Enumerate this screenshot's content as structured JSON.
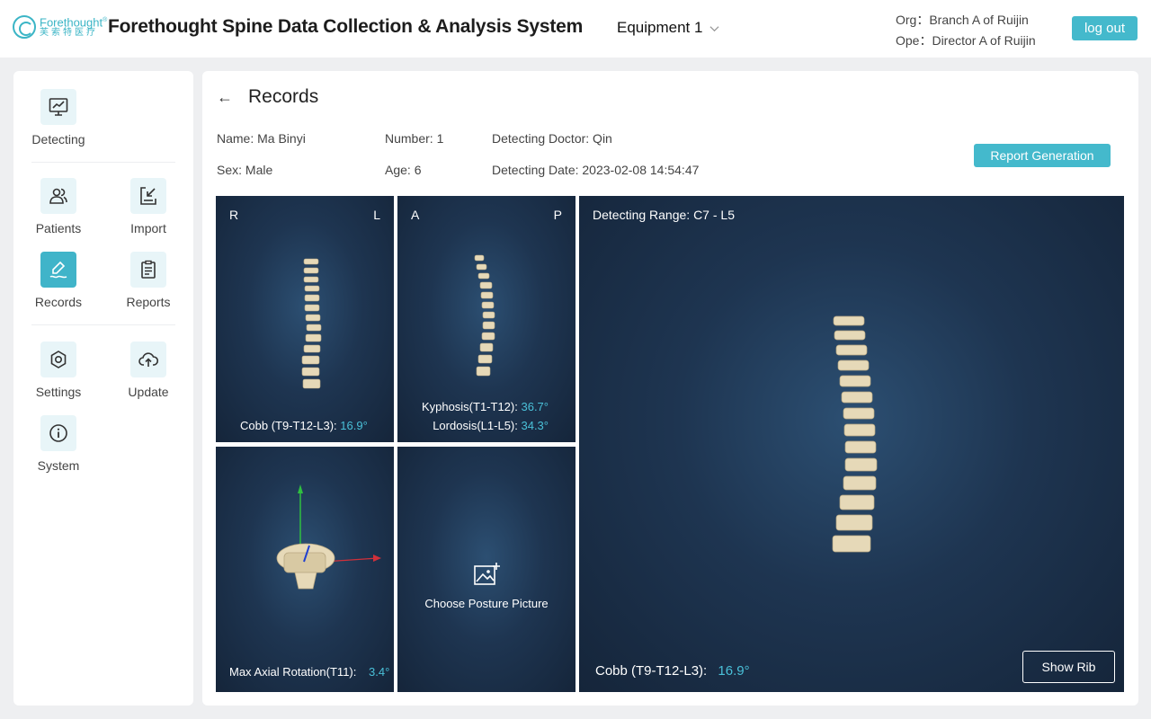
{
  "header": {
    "logo_en": "Forethought",
    "logo_cn": "芙索特医疗",
    "title": "Forethought Spine Data Collection & Analysis System",
    "equipment": "Equipment 1",
    "org": "Org：Branch A of Ruijin",
    "ope": "Ope：Director A of Ruijin",
    "logout_label": "log out"
  },
  "sidebar": {
    "detecting": "Detecting",
    "patients": "Patients",
    "import": "Import",
    "records": "Records",
    "reports": "Reports",
    "settings": "Settings",
    "update": "Update",
    "system": "System"
  },
  "page": {
    "back": "←",
    "title": "Records",
    "report_button": "Report Generation"
  },
  "patient": {
    "name": "Name: Ma Binyi",
    "number": "Number: 1",
    "doctor": "Detecting Doctor: Qin",
    "sex": "Sex: Male",
    "age": "Age: 6",
    "date": "Detecting Date: 2023-02-08 14:54:47"
  },
  "panels": {
    "coronal": {
      "left": "R",
      "right": "L",
      "label": "Cobb (T9-T12-L3):",
      "value": "16.9°"
    },
    "sagittal": {
      "left": "A",
      "right": "P",
      "kyphosis_label": "Kyphosis(T1-T12):",
      "kyphosis_value": "36.7°",
      "lordosis_label": "Lordosis(L1-L5):",
      "lordosis_value": "34.3°"
    },
    "rotation": {
      "label": "Max Axial Rotation(T11):",
      "value": "3.4°"
    },
    "posture": {
      "label": "Choose Posture Picture"
    },
    "main": {
      "range": "Detecting Range: C7 - L5",
      "label": "Cobb (T9-T12-L3):",
      "value": "16.9°",
      "show_rib": "Show Rib"
    }
  },
  "colors": {
    "accent": "#44b9cc",
    "panel_dark": "#1e3551",
    "value_blue": "#4ac0d8"
  }
}
